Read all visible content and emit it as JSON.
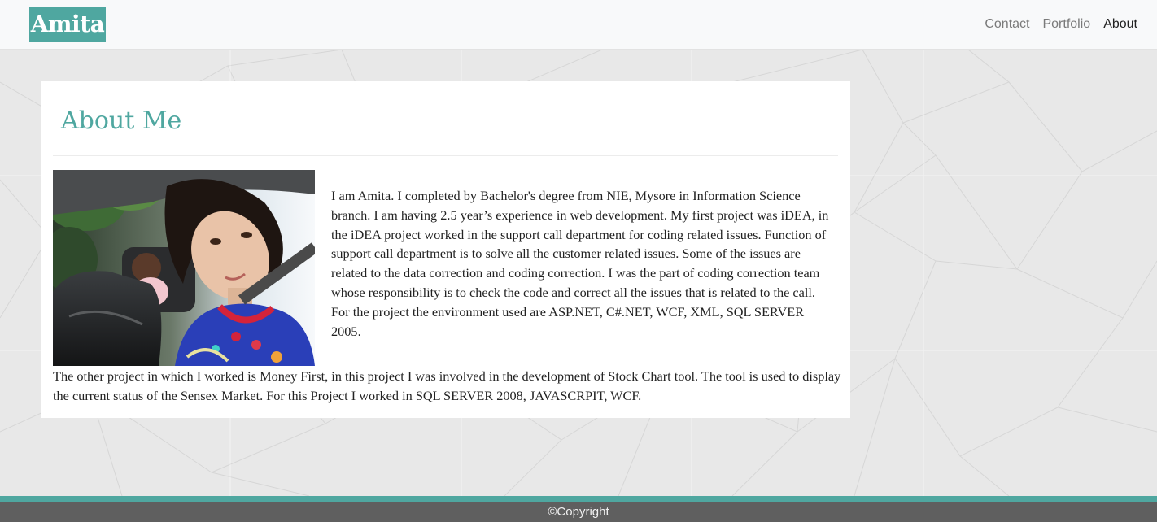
{
  "header": {
    "brand": "Amita",
    "nav": [
      {
        "label": "Contact"
      },
      {
        "label": "Portfolio"
      },
      {
        "label": "About"
      }
    ]
  },
  "main": {
    "title": "About Me",
    "paragraphs": [
      "I am Amita. I completed by Bachelor's degree from NIE, Mysore in Information Science branch. I am having 2.5 year’s experience in web development. My first project was iDEA, in the iDEA project worked in the support call department for coding related issues. Function of support call department is to solve all the customer related issues. Some of the issues are related to the data correction and coding correction. I was the part of coding correction team whose responsibility is to check the code and correct all the issues that is related to the call. For the project the environment used are ASP.NET, C#.NET, WCF, XML, SQL SERVER 2005.",
      "The other project in which I worked is Money First, in this project I was involved in the development of Stock Chart tool. The tool is used to display the current status of the Sensex Market. For this Project I worked in SQL SERVER 2008, JAVASCRPIT, WCF."
    ]
  },
  "footer": {
    "text": "©Copyright"
  },
  "theme": {
    "accent": "#4fa7a0",
    "page_background": "#e8e8e8",
    "footer_background": "#5f5f5f"
  }
}
